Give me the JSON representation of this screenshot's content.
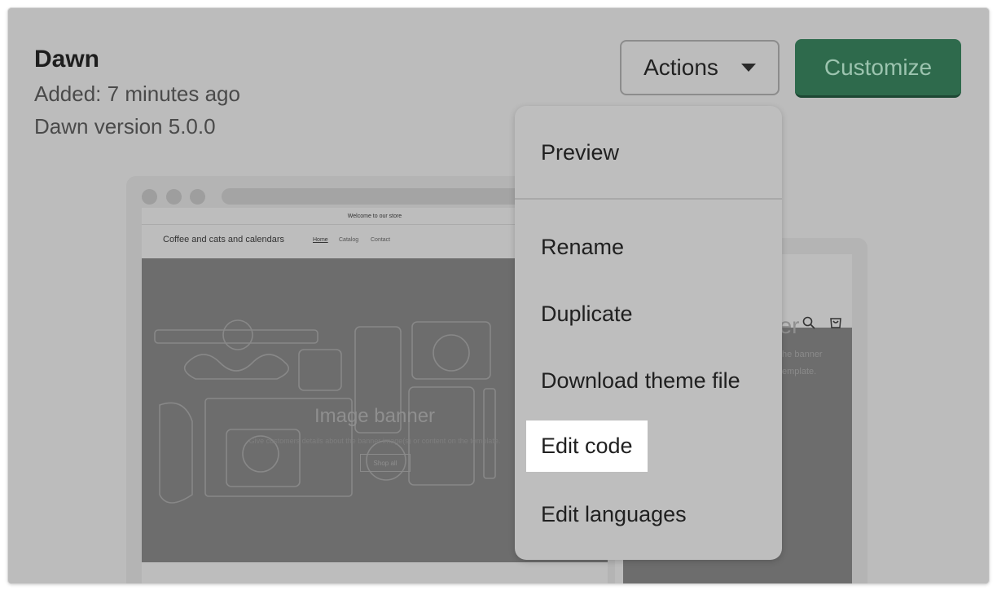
{
  "theme": {
    "name": "Dawn",
    "added": "Added: 7 minutes ago",
    "version": "Dawn version 5.0.0"
  },
  "header": {
    "actions_label": "Actions",
    "customize_label": "Customize"
  },
  "preview": {
    "announcement": "Welcome to our store",
    "store_name": "Coffee and cats and calendars",
    "nav": [
      "Home",
      "Catalog",
      "Contact"
    ],
    "banner_title": "Image banner",
    "banner_subtitle": "Give customers details about the banner image(s) or content on the template.",
    "button": "Shop all",
    "mobile_banner_title": "ner",
    "mobile_sub_1": "the banner",
    "mobile_sub_2": "emplate."
  },
  "actions_menu": {
    "items": [
      "Preview",
      "Rename",
      "Duplicate",
      "Download theme file",
      "Edit code",
      "Edit languages"
    ],
    "highlighted": "Edit code"
  },
  "colors": {
    "overlay": "#bcbcbc",
    "customize_button": "#2e6a4c",
    "highlight": "#ffffff"
  }
}
